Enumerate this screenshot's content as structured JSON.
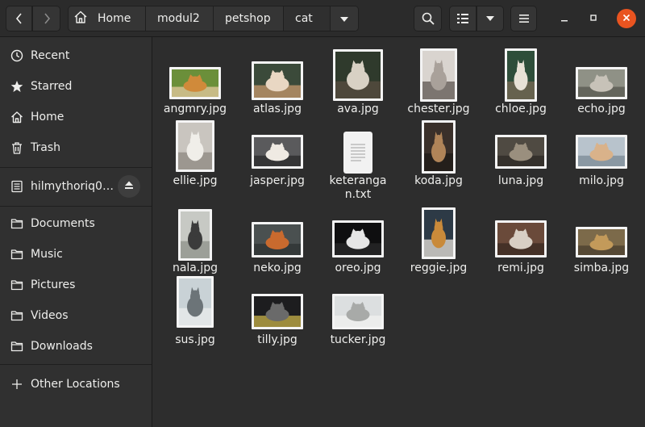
{
  "header": {
    "nav_back_icon": "go-previous-icon",
    "nav_forward_icon": "go-next-icon",
    "breadcrumbs": [
      "Home",
      "modul2",
      "petshop",
      "cat"
    ],
    "search_icon": "search-icon",
    "view_icon": "list-view-icon",
    "menu_icon": "hamburger-menu-icon",
    "window_controls": [
      "minimize-icon",
      "maximize-icon",
      "close-icon"
    ]
  },
  "sidebar": {
    "items": [
      {
        "label": "Recent",
        "icon": "clock-icon"
      },
      {
        "label": "Starred",
        "icon": "star-icon"
      },
      {
        "label": "Home",
        "icon": "home-icon"
      },
      {
        "label": "Trash",
        "icon": "trash-icon"
      },
      {
        "label": "hilmythoriq0…",
        "icon": "drive-icon"
      },
      {
        "label": "Documents",
        "icon": "folder-icon"
      },
      {
        "label": "Music",
        "icon": "folder-icon"
      },
      {
        "label": "Pictures",
        "icon": "folder-icon"
      },
      {
        "label": "Videos",
        "icon": "folder-icon"
      },
      {
        "label": "Downloads",
        "icon": "folder-icon"
      },
      {
        "label": "Other Locations",
        "icon": "plus-icon"
      }
    ]
  },
  "files": [
    {
      "name": "angmry.jpg",
      "kind": "image",
      "colors": [
        "#6b8f3a",
        "#d08a3a",
        "#e6c9a0"
      ]
    },
    {
      "name": "atlas.jpg",
      "kind": "image",
      "colors": [
        "#3b4a3a",
        "#e9d7c3",
        "#c89a6e"
      ]
    },
    {
      "name": "ava.jpg",
      "kind": "image",
      "colors": [
        "#2f3a2c",
        "#d8d1c4",
        "#5a4e40"
      ]
    },
    {
      "name": "chester.jpg",
      "kind": "image",
      "colors": [
        "#d9d4cf",
        "#a9a19a",
        "#5c5550"
      ]
    },
    {
      "name": "chloe.jpg",
      "kind": "image",
      "colors": [
        "#2e4e3a",
        "#e8e2d6",
        "#7a6a55"
      ]
    },
    {
      "name": "echo.jpg",
      "kind": "image",
      "colors": [
        "#8f9186",
        "#c7c2b8",
        "#55574d"
      ]
    },
    {
      "name": "ellie.jpg",
      "kind": "image",
      "colors": [
        "#c9c5bf",
        "#f0eee9",
        "#8c8780"
      ]
    },
    {
      "name": "jasper.jpg",
      "kind": "image",
      "colors": [
        "#5a5a5c",
        "#efeae3",
        "#2a2a2a"
      ]
    },
    {
      "name": "keterangan.txt",
      "kind": "text",
      "colors": [
        "#f2f2f2",
        "#c8c8c8",
        "#a0a0a0"
      ]
    },
    {
      "name": "koda.jpg",
      "kind": "image",
      "colors": [
        "#3a302a",
        "#b08458",
        "#1e1a17"
      ]
    },
    {
      "name": "luna.jpg",
      "kind": "image",
      "colors": [
        "#4f4a42",
        "#9a8f7e",
        "#2c2a26"
      ]
    },
    {
      "name": "milo.jpg",
      "kind": "image",
      "colors": [
        "#b8c3cc",
        "#d9b28a",
        "#7b8a96"
      ]
    },
    {
      "name": "nala.jpg",
      "kind": "image",
      "colors": [
        "#c7c9c4",
        "#3b3b3b",
        "#8e9089"
      ]
    },
    {
      "name": "neko.jpg",
      "kind": "image",
      "colors": [
        "#4a5050",
        "#c96a2e",
        "#2e3232"
      ]
    },
    {
      "name": "oreo.jpg",
      "kind": "image",
      "colors": [
        "#0f0f10",
        "#e6e6e6",
        "#2a2a2a"
      ]
    },
    {
      "name": "reggie.jpg",
      "kind": "image",
      "colors": [
        "#2d3a46",
        "#c98a3a",
        "#e9e4dc"
      ]
    },
    {
      "name": "remi.jpg",
      "kind": "image",
      "colors": [
        "#6a4a3a",
        "#d8cfc4",
        "#3a2a22"
      ]
    },
    {
      "name": "simba.jpg",
      "kind": "image",
      "colors": [
        "#7c6a4a",
        "#c39a5a",
        "#4a3f2f"
      ]
    },
    {
      "name": "sus.jpg",
      "kind": "image",
      "colors": [
        "#c9d2d6",
        "#6c7478",
        "#e9ecec"
      ]
    },
    {
      "name": "tilly.jpg",
      "kind": "image",
      "colors": [
        "#1d1d1f",
        "#6a6a6a",
        "#c8b24a"
      ]
    },
    {
      "name": "tucker.jpg",
      "kind": "image",
      "colors": [
        "#dcdfe0",
        "#a8aaa8",
        "#f2f2f0"
      ]
    }
  ]
}
